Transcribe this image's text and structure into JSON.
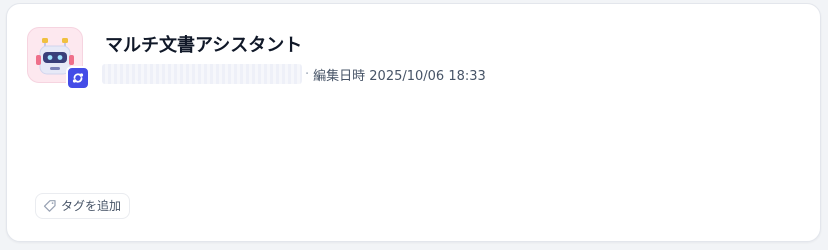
{
  "app": {
    "title": "マルチ文書アシスタント",
    "meta_separator": "·",
    "edited_text": "編集日時 2025/10/06 18:33",
    "icon_bg": "#fde8ef",
    "badge_color": "#444ce7",
    "icons": {
      "app": "robot-icon",
      "badge": "workflow-icon",
      "tag": "tag-icon"
    }
  },
  "tag_button": {
    "label": "タグを追加"
  }
}
